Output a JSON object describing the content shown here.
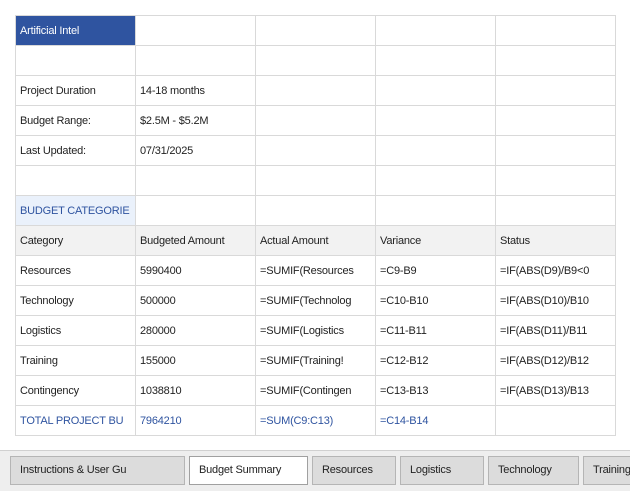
{
  "sheet": {
    "rows": [
      [
        "Artificial Intel",
        "",
        "",
        "",
        ""
      ],
      [
        "",
        "",
        "",
        "",
        ""
      ],
      [
        "Project Duration",
        "14-18 months",
        "",
        "",
        ""
      ],
      [
        "Budget Range:",
        "$2.5M - $5.2M",
        "",
        "",
        ""
      ],
      [
        "Last Updated:",
        "07/31/2025",
        "",
        "",
        ""
      ],
      [
        "",
        "",
        "",
        "",
        ""
      ],
      [
        "BUDGET CATEGORIE",
        "",
        "",
        "",
        ""
      ],
      [
        "Category",
        "Budgeted Amount",
        "Actual Amount",
        "Variance",
        "Status"
      ],
      [
        "Resources",
        "5990400",
        "=SUMIF(Resources",
        "=C9-B9",
        "=IF(ABS(D9)/B9<0"
      ],
      [
        "Technology",
        "500000",
        "=SUMIF(Technolog",
        "=C10-B10",
        "=IF(ABS(D10)/B10"
      ],
      [
        "Logistics",
        "280000",
        "=SUMIF(Logistics",
        "=C11-B11",
        "=IF(ABS(D11)/B11"
      ],
      [
        "Training",
        "155000",
        "=SUMIF(Training!",
        "=C12-B12",
        "=IF(ABS(D12)/B12"
      ],
      [
        "Contingency",
        "1038810",
        "=SUMIF(Contingen",
        "=C13-B13",
        "=IF(ABS(D13)/B13"
      ],
      [
        "TOTAL PROJECT BU",
        "7964210",
        "=SUM(C9:C13)",
        "=C14-B14",
        ""
      ]
    ]
  },
  "tabs": [
    {
      "label": "Instructions & User Gu",
      "active": false
    },
    {
      "label": "Budget Summary",
      "active": true
    },
    {
      "label": "Resources",
      "active": false
    },
    {
      "label": "Logistics",
      "active": false
    },
    {
      "label": "Technology",
      "active": false
    },
    {
      "label": "Training",
      "active": false
    }
  ],
  "colors": {
    "title_fill": "#2f54a0",
    "section_fill": "#eaf1fb",
    "header_fill": "#f2f2f2",
    "accent_text": "#2f54a0"
  }
}
